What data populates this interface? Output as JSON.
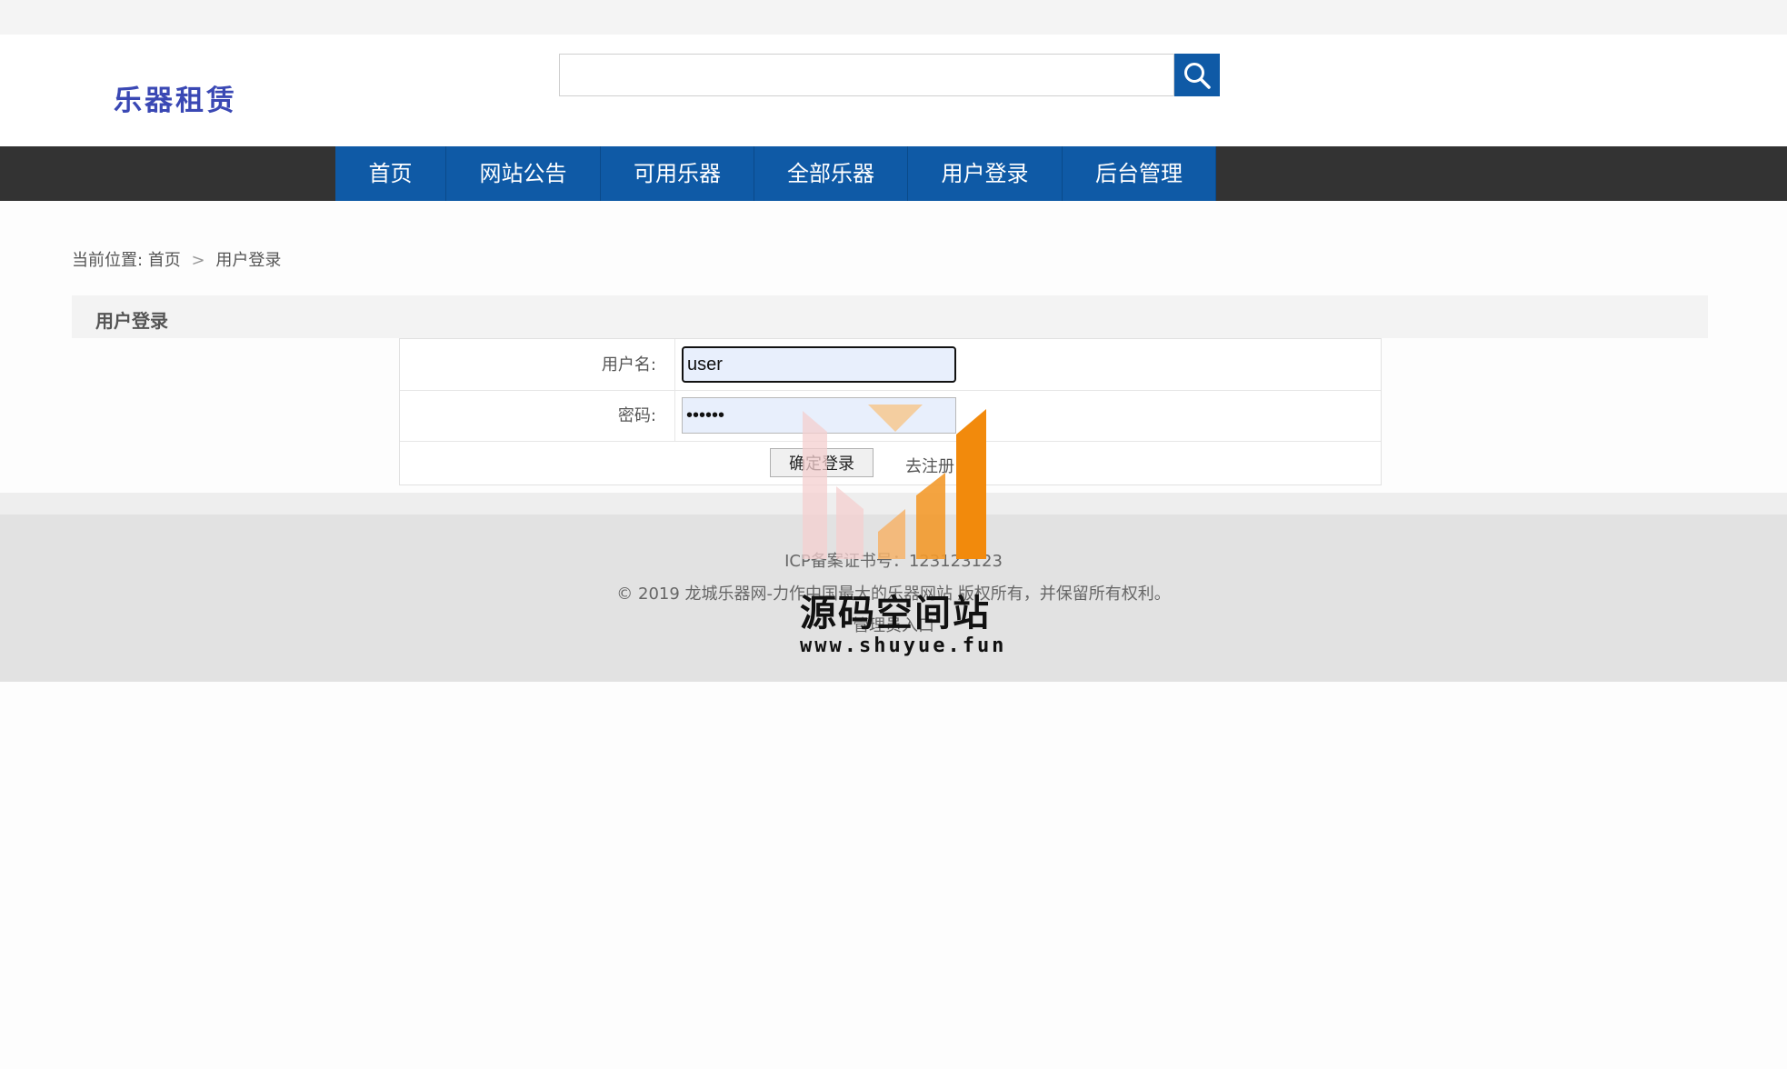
{
  "header": {
    "logo_text": "乐器租赁",
    "search": {
      "value": "",
      "placeholder": ""
    }
  },
  "nav": {
    "items": [
      {
        "label": "首页"
      },
      {
        "label": "网站公告"
      },
      {
        "label": "可用乐器"
      },
      {
        "label": "全部乐器"
      },
      {
        "label": "用户登录"
      },
      {
        "label": "后台管理"
      }
    ]
  },
  "breadcrumb": {
    "prefix": "当前位置:",
    "home": "首页",
    "separator": ">",
    "current": "用户登录"
  },
  "login": {
    "title": "用户登录",
    "username_label": "用户名:",
    "username_value": "user",
    "password_label": "密码:",
    "password_value": "••••••",
    "submit_label": "确定登录",
    "register_link": "去注册"
  },
  "footer": {
    "icp": "ICP备案证书号：123123123",
    "copyright": "© 2019 龙城乐器网-力作中国最大的乐器网站 版权所有，并保留所有权利。",
    "admin_link": "管理员入口"
  },
  "watermark": {
    "title": "源码空间站",
    "url": "www.shuyue.fun"
  },
  "colors": {
    "nav_blue": "#0f5aa6",
    "nav_bar": "#333333",
    "logo": "#3a48b4",
    "watermark_orange": "#f28a0c"
  }
}
